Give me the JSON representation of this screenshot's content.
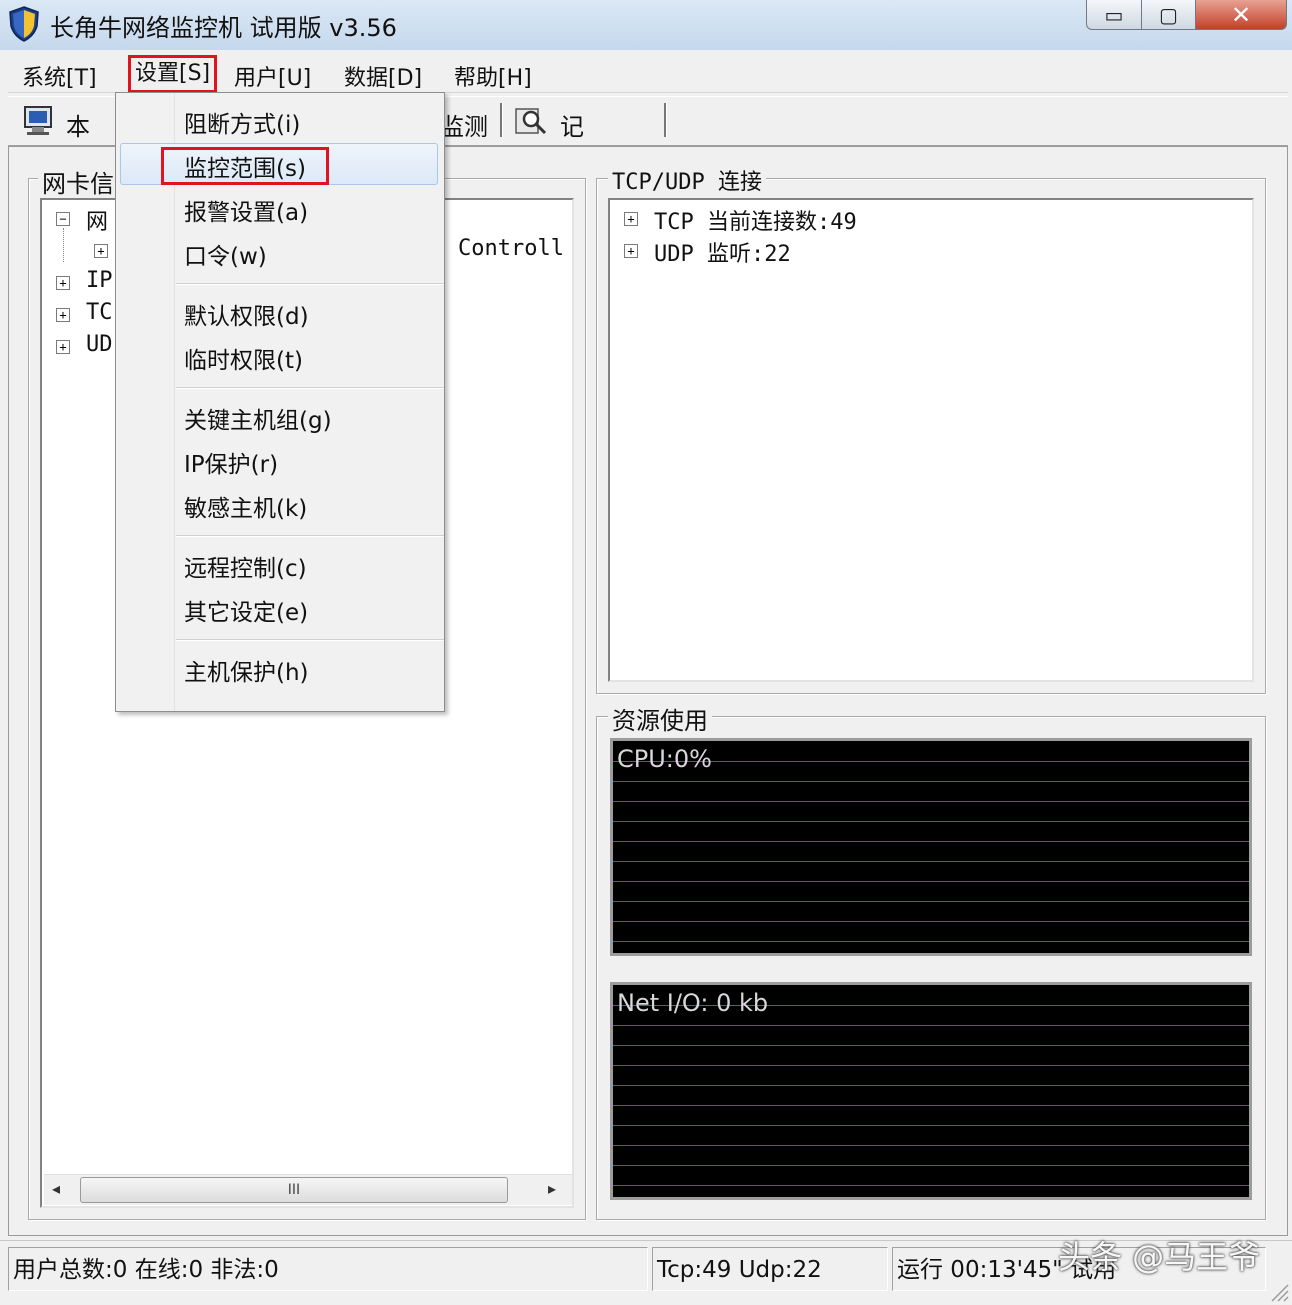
{
  "window": {
    "title": "长角牛网络监控机 试用版 v3.56",
    "min_symbol": "▭",
    "max_symbol": "▢",
    "close_symbol": "✕"
  },
  "menubar": {
    "system": "系统[T]",
    "settings": "设置[S]",
    "user": "用户[U]",
    "data": "数据[D]",
    "help": "帮助[H]"
  },
  "toolbar": {
    "local_label": "本机",
    "monitor_label": "监测",
    "records_label": "记录查询"
  },
  "left_panel": {
    "group_label": "网卡信",
    "tree": {
      "row1": "网",
      "row2_text": "Controll",
      "row3": "IP",
      "row4": "TC",
      "row5": "UD"
    },
    "scroll_thumb": "III",
    "scroll_left": "◂",
    "scroll_right": "▸"
  },
  "tcp_panel": {
    "group_label": "TCP/UDP 连接",
    "tcp_row": "TCP 当前连接数:49",
    "udp_row": "UDP 监听:22"
  },
  "resource_panel": {
    "group_label": "资源使用",
    "cpu_label": "CPU:0%",
    "net_label": "Net I/O: 0 kb"
  },
  "dropdown": {
    "items": [
      "阻断方式(i)",
      "监控范围(s)",
      "报警设置(a)",
      "口令(w)",
      "默认权限(d)",
      "临时权限(t)",
      "关键主机组(g)",
      "IP保护(r)",
      "敏感主机(k)",
      "远程控制(c)",
      "其它设定(e)",
      "主机保护(h)"
    ]
  },
  "statusbar": {
    "users": "用户总数:0 在线:0 非法:0",
    "conn": "Tcp:49 Udp:22",
    "runtime": "运行 00:13'45\" 试用",
    "watermark": "头条 @马王爷"
  },
  "colors": {
    "highlight_red": "#e0141e",
    "graph_grid": "#1a8a1a",
    "graph_bg": "#000000"
  }
}
